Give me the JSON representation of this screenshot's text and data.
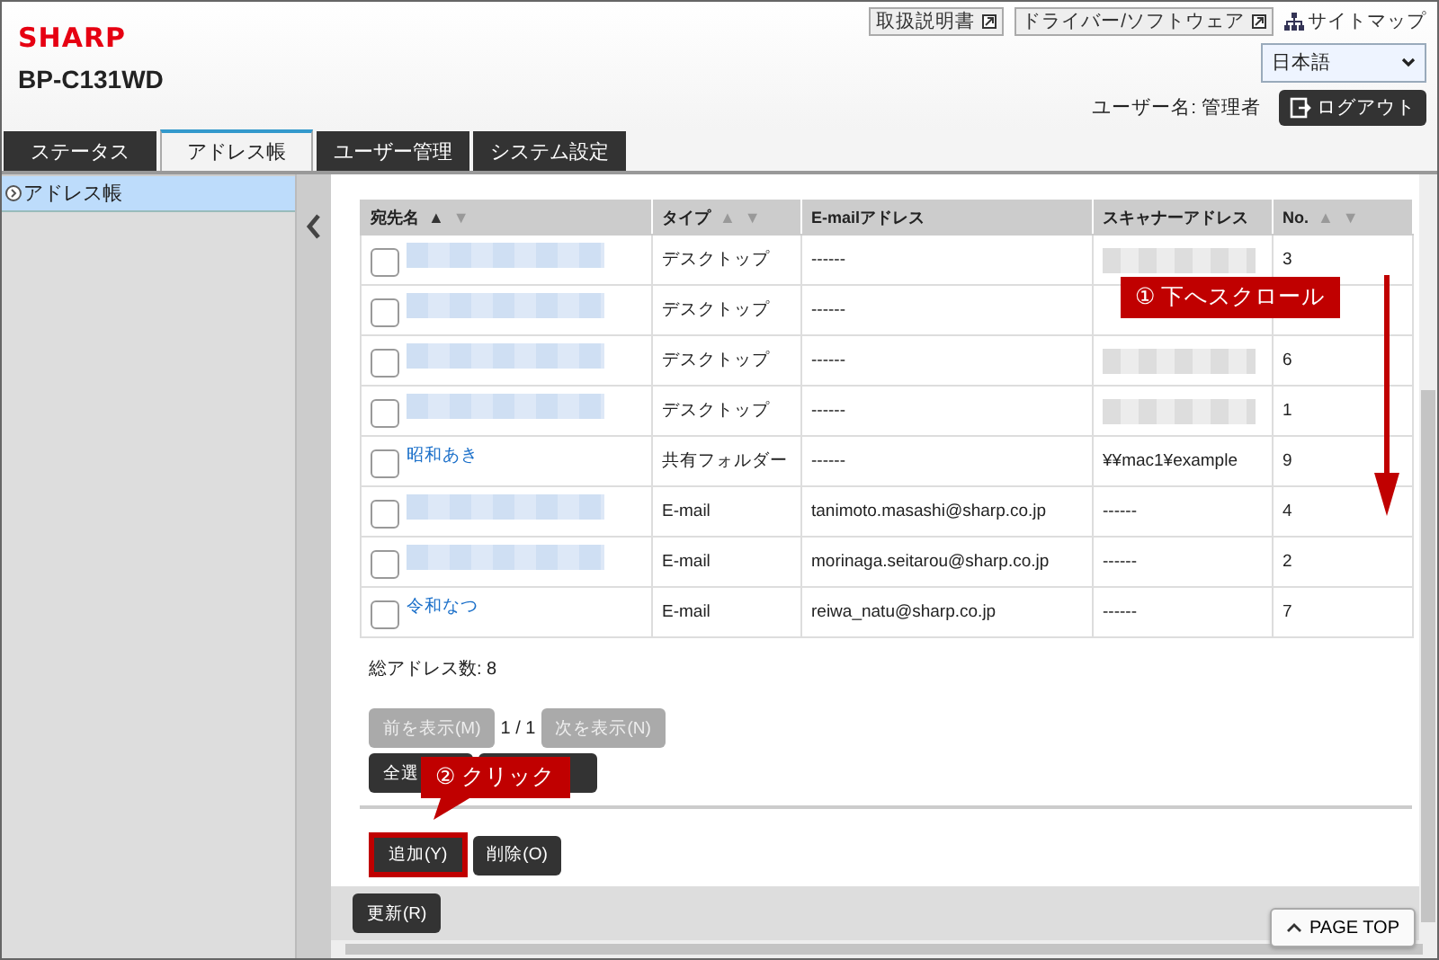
{
  "header": {
    "brand": "SHARP",
    "model": "BP-C131WD",
    "links": [
      {
        "label": "取扱説明書",
        "kind": "external"
      },
      {
        "label": "ドライバー/ソフトウェア",
        "kind": "external"
      },
      {
        "label": "サイトマップ",
        "kind": "sitemap"
      }
    ],
    "language": "日本語",
    "user_label": "ユーザー名: 管理者",
    "logout": "ログアウト"
  },
  "tabs": [
    {
      "label": "ステータス",
      "selected": false
    },
    {
      "label": "アドレス帳",
      "selected": true
    },
    {
      "label": "ユーザー管理",
      "selected": false
    },
    {
      "label": "システム設定",
      "selected": false
    }
  ],
  "sidebar": {
    "items": [
      {
        "label": "アドレス帳",
        "selected": true
      }
    ]
  },
  "table": {
    "columns": [
      {
        "label": "宛先名",
        "sort_up": "▲",
        "sort_down": "▼",
        "sort_ascending_active": true
      },
      {
        "label": "タイプ",
        "sort_up": "▲",
        "sort_down": "▼",
        "sort_ascending_active": false
      },
      {
        "label": "E-mailアドレス"
      },
      {
        "label": "スキャナーアドレス"
      },
      {
        "label": "No.",
        "sort_up": "▲",
        "sort_down": "▼",
        "sort_ascending_active": false
      }
    ],
    "rows": [
      {
        "checked": false,
        "name": {
          "kind": "blurred"
        },
        "type": "デスクトップ",
        "email": "------",
        "scanner": {
          "kind": "blurred"
        },
        "no": "3"
      },
      {
        "checked": false,
        "name": {
          "kind": "blurred"
        },
        "type": "デスクトップ",
        "email": "------",
        "scanner": {
          "kind": "hidden"
        }
      },
      {
        "checked": false,
        "name": {
          "kind": "blurred"
        },
        "type": "デスクトップ",
        "email": "------",
        "scanner": {
          "kind": "blurred"
        },
        "no": "6"
      },
      {
        "checked": false,
        "name": {
          "kind": "blurred"
        },
        "type": "デスクトップ",
        "email": "------",
        "scanner": {
          "kind": "blurred"
        },
        "no": "1"
      },
      {
        "checked": false,
        "name": {
          "kind": "link",
          "text": "昭和あき"
        },
        "type": "共有フォルダー",
        "email": "------",
        "scanner": {
          "kind": "text",
          "text": "¥¥mac1¥example"
        },
        "no": "9"
      },
      {
        "checked": false,
        "name": {
          "kind": "blurred"
        },
        "type": "E-mail",
        "email": "tanimoto.masashi@sharp.co.jp",
        "scanner": {
          "kind": "text",
          "text": "------"
        },
        "no": "4"
      },
      {
        "checked": false,
        "name": {
          "kind": "blurred"
        },
        "type": "E-mail",
        "email": "morinaga.seitarou@sharp.co.jp",
        "scanner": {
          "kind": "text",
          "text": "------"
        },
        "no": "2"
      },
      {
        "checked": false,
        "name": {
          "kind": "link",
          "text": "令和なつ"
        },
        "type": "E-mail",
        "email": "reiwa_natu@sharp.co.jp",
        "scanner": {
          "kind": "text",
          "text": "------"
        },
        "no": "7"
      }
    ]
  },
  "count_label": "総アドレス数: 8",
  "pager": {
    "prev": {
      "label": "前を表示(M)",
      "disabled": true
    },
    "page": "1 / 1",
    "next": {
      "label": "次を表示(N)",
      "disabled": true
    }
  },
  "select_buttons": [
    {
      "label": "全選"
    }
  ],
  "actions": [
    {
      "label": "追加(Y)",
      "highlighted": true
    },
    {
      "label": "削除(O)",
      "highlighted": false
    }
  ],
  "refresh": "更新(R)",
  "page_top": "PAGE TOP",
  "annotations": [
    {
      "kind": "scroll",
      "text": "① 下へスクロール"
    },
    {
      "kind": "click",
      "text": "② クリック"
    }
  ]
}
